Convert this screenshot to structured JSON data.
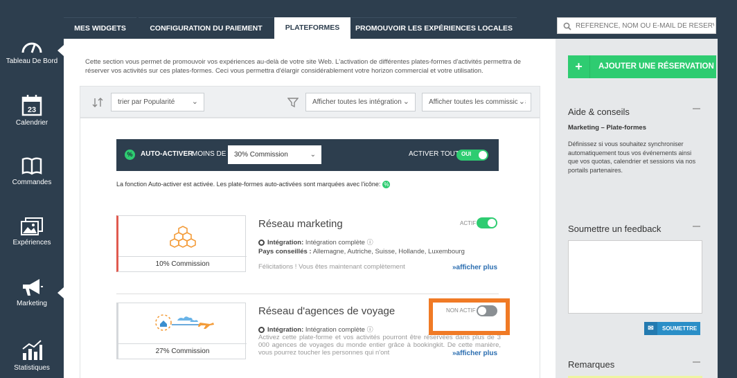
{
  "sidebar": {
    "items": [
      {
        "label": "Tableau De Bord",
        "icon": "dashboard-icon"
      },
      {
        "label": "Calendrier",
        "icon": "calendar-icon",
        "day": "23"
      },
      {
        "label": "Commandes",
        "icon": "book-icon"
      },
      {
        "label": "Expériences",
        "icon": "pictures-icon"
      },
      {
        "label": "Marketing",
        "icon": "megaphone-icon"
      },
      {
        "label": "Statistiques",
        "icon": "chart-icon"
      }
    ]
  },
  "tabs": [
    {
      "label": "MES WIDGETS"
    },
    {
      "label": "CONFIGURATION DU PAIEMENT"
    },
    {
      "label": "PLATEFORMES"
    },
    {
      "label": "PROMOUVOIR LES EXPÉRIENCES LOCALES"
    }
  ],
  "search": {
    "placeholder": "RÉFÉRENCE, NOM OU E-MAIL DE RÉSERVATION"
  },
  "intro": "Cette section vous permet de promouvoir vos expériences au-delà de votre site Web. L'activation de différentes plates-formes d'activités permettra de réserver vos activités sur ces plates-formes. Ceci vous permettra d'élargir considérablement votre horizon commercial et votre utilisation.",
  "filters": {
    "sort": "trier par Popularité",
    "integrations": "Afficher toutes les intégrations",
    "commissions": "Afficher toutes les commissions"
  },
  "auto": {
    "label_bold": "AUTO-ACTIVER",
    "label": "MOINS DE",
    "commission": "30% Commission",
    "activate_all": "ACTIVER TOUT",
    "toggle": "OUI",
    "icon": "%"
  },
  "note": "La fonction Auto-activer est activée. Les plate-formes auto-activées sont marquées avec l'icône:",
  "platforms": [
    {
      "title": "Réseau marketing",
      "commission": "10% Commission",
      "status": "ACTIF",
      "integration_label": "Intégration:",
      "integration": "Intégration complète",
      "countries_label": "Pays conseillés :",
      "countries": "Allemagne, Autriche, Suisse, Hollande, Luxembourg",
      "text": "Félicitations ! Vous êtes maintenant complètement",
      "more": "»afficher plus"
    },
    {
      "title": "Réseau d'agences de voyage",
      "commission": "27% Commission",
      "status": "NON ACTIF",
      "integration_label": "Intégration:",
      "integration": "Intégration complète",
      "text": "Activez cette plate-forme et vos activités pourront être réservées dans plus de 3 000 agences de voyages du monde entier grâce à bookingkit. De cette manière, vous pourrez toucher les personnes qui n'ont",
      "more": "»afficher plus"
    }
  ],
  "right": {
    "add_button": "AJOUTER UNE RÉSERVATION",
    "help_title": "Aide & conseils",
    "help_heading": "Marketing – Plate-formes",
    "help_text": "Définissez si vous souhaitez synchroniser automatiquement tous vos événements ainsi que vos quotas, calendrier et sessions via nos portails partenaires.",
    "feedback_title": "Soumettre un feedback",
    "submit": "SOUMETTRE",
    "remarks_title": "Remarques"
  },
  "colors": {
    "navy": "#2d3e4e",
    "green": "#2ecc71",
    "highlight": "#f07a25",
    "link": "#2a6db0"
  }
}
